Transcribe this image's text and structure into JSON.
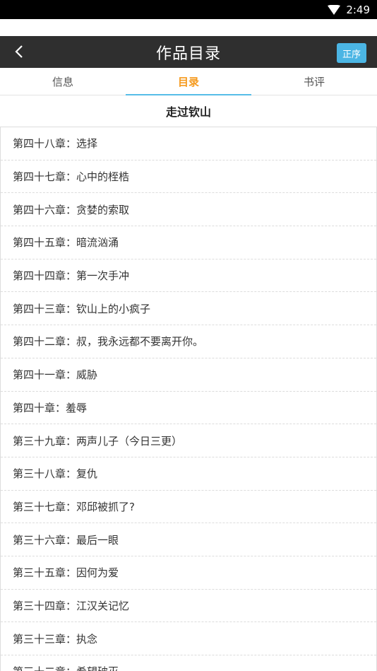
{
  "status_bar": {
    "time": "2:49",
    "wifi_icon": "wifi-icon"
  },
  "header": {
    "title": "作品目录",
    "sort_label": "正序",
    "back_icon": "chevron-left-icon"
  },
  "tabs": [
    {
      "label": "信息",
      "active": false
    },
    {
      "label": "目录",
      "active": true
    },
    {
      "label": "书评",
      "active": false
    }
  ],
  "book_title": "走过钦山",
  "chapters": [
    "第四十八章：选择",
    "第四十七章：心中的桎梏",
    "第四十六章：贪婪的索取",
    "第四十五章：暗流汹涌",
    "第四十四章：第一次手冲",
    "第四十三章：钦山上的小疯子",
    "第四十二章：叔，我永远都不要离开你。",
    "第四十一章：威胁",
    "第四十章：羞辱",
    "第三十九章：两声儿子（今日三更）",
    "第三十八章：复仇",
    "第三十七章：邓邱被抓了?",
    "第三十六章：最后一眼",
    "第三十五章：因何为爱",
    "第三十四章：江汉关记忆",
    "第三十三章：执念",
    "第三十二章：希望破灭"
  ],
  "colors": {
    "header_bg": "#2f2f2f",
    "sort_button": "#4bb5e4",
    "active_tab": "#f59a1e",
    "tab_underline": "#57bde8"
  }
}
